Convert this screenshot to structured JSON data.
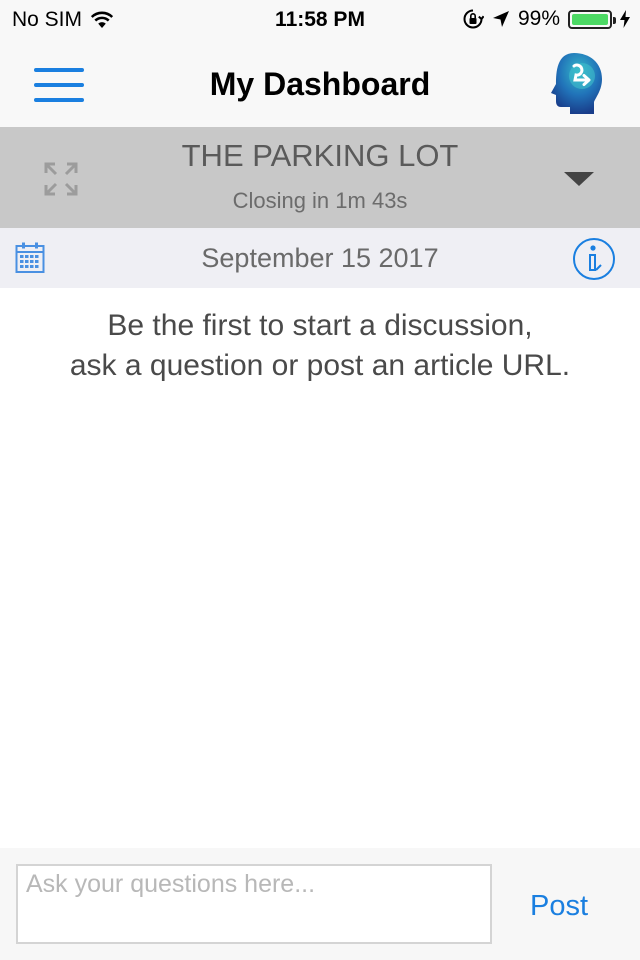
{
  "status_bar": {
    "carrier": "No SIM",
    "time": "11:58 PM",
    "battery_percent": "99%",
    "battery_level": 0.99,
    "icons": [
      "wifi-icon",
      "rotation-lock-icon",
      "location-arrow-icon",
      "battery-icon",
      "charging-bolt-icon"
    ]
  },
  "nav": {
    "title": "My Dashboard",
    "menu_icon": "hamburger-menu-icon",
    "logo_icon": "brain-logo-icon"
  },
  "panel": {
    "title": "THE PARKING LOT",
    "subtitle": "Closing in 1m 43s",
    "expand_icon": "expand-arrows-icon",
    "dropdown_icon": "caret-down-icon"
  },
  "date_bar": {
    "date": "September 15 2017",
    "calendar_icon": "calendar-icon",
    "info_icon": "info-icon"
  },
  "main": {
    "empty_line1": "Be the first to start a discussion,",
    "empty_line2": "ask a question or post an article URL."
  },
  "footer": {
    "input_placeholder": "Ask your questions here...",
    "input_value": "",
    "post_label": "Post"
  },
  "colors": {
    "accent": "#1a7fe0",
    "panel_bg": "#c8c8c8",
    "date_bar_bg": "#efeff4",
    "battery_green": "#4cd964"
  }
}
